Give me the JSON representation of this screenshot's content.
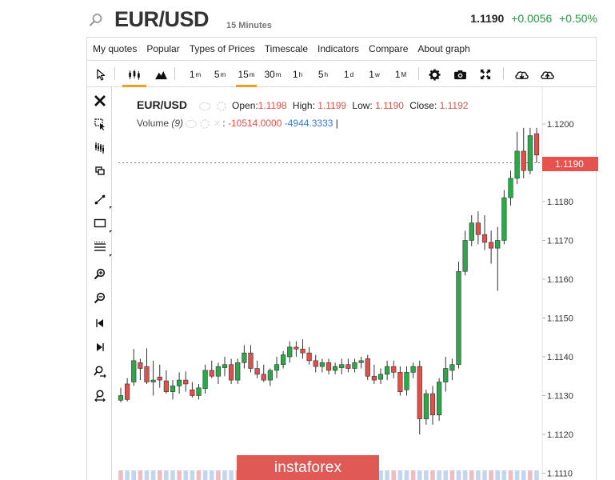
{
  "header": {
    "symbol": "EUR/USD",
    "timeframe": "15 Minutes",
    "last_price": "1.1190",
    "change": "+0.0056",
    "change_pct": "+0.50%",
    "colors": {
      "up": "#1e9b3b",
      "down": "#e0504a"
    }
  },
  "menu": {
    "items": [
      "My quotes",
      "Popular",
      "Types of Prices",
      "Timescale",
      "Indicators",
      "Compare",
      "About graph"
    ]
  },
  "toolbar": {
    "cursor_icon": "cursor-icon",
    "chart_types": [
      "candlestick-icon",
      "mountain-icon"
    ],
    "intervals": [
      {
        "value": "1",
        "unit": "m"
      },
      {
        "value": "5",
        "unit": "m"
      },
      {
        "value": "15",
        "unit": "m"
      },
      {
        "value": "30",
        "unit": "m"
      },
      {
        "value": "1",
        "unit": "h"
      },
      {
        "value": "5",
        "unit": "h"
      },
      {
        "value": "1",
        "unit": "d"
      },
      {
        "value": "1",
        "unit": "w"
      },
      {
        "value": "1",
        "unit": "M"
      }
    ],
    "active_interval": "15m",
    "actions": [
      "settings-icon",
      "camera-icon",
      "fullscreen-icon",
      "download-icon",
      "upload-icon"
    ]
  },
  "left_tools": [
    "close-icon",
    "cursor-select-icon",
    "magnet-icon",
    "copy-icon",
    "line-tool-icon",
    "rectangle-tool-icon",
    "horizontal-lines-icon",
    "zoom-in-icon",
    "zoom-out-icon",
    "scroll-left-icon",
    "scroll-right-icon",
    "zoom-time-icon",
    "zoom-reset-icon"
  ],
  "legend": {
    "symbol": "EUR/USD",
    "open_label": "Open:",
    "open": "1.1198",
    "high_label": "High:",
    "high": "1.1199",
    "low_label": "Low:",
    "low": "1.1190",
    "close_label": "Close:",
    "close": "1.1192",
    "volume_name": "Volume",
    "volume_period": "(9)",
    "volume_value1": "-10514.0000",
    "volume_value2": "-4944.3333"
  },
  "current_price_tag": "1.1190",
  "watermark": "instaforex",
  "chart_data": {
    "type": "candlestick",
    "y_axis_ticks": [
      "1.1200",
      "1.1190",
      "1.1180",
      "1.1170",
      "1.1160",
      "1.1150",
      "1.1140",
      "1.1130",
      "1.1120",
      "1.1110"
    ],
    "ylim": [
      1.1109,
      1.1208
    ],
    "current_price": 1.119,
    "up_color": "#2ba84a",
    "down_color": "#e0504a",
    "candles": [
      {
        "o": 1.11288,
        "h": 1.1132,
        "l": 1.11283,
        "c": 1.113
      },
      {
        "o": 1.1133,
        "h": 1.11345,
        "l": 1.11285,
        "c": 1.1129
      },
      {
        "o": 1.11335,
        "h": 1.1142,
        "l": 1.11325,
        "c": 1.1139
      },
      {
        "o": 1.11385,
        "h": 1.11395,
        "l": 1.1134,
        "c": 1.1137
      },
      {
        "o": 1.11375,
        "h": 1.11422,
        "l": 1.1133,
        "c": 1.11335
      },
      {
        "o": 1.11335,
        "h": 1.1139,
        "l": 1.113,
        "c": 1.1134
      },
      {
        "o": 1.11348,
        "h": 1.1138,
        "l": 1.1132,
        "c": 1.1134
      },
      {
        "o": 1.11338,
        "h": 1.11365,
        "l": 1.11305,
        "c": 1.1131
      },
      {
        "o": 1.1131,
        "h": 1.1134,
        "l": 1.1129,
        "c": 1.11325
      },
      {
        "o": 1.11325,
        "h": 1.1136,
        "l": 1.11305,
        "c": 1.1134
      },
      {
        "o": 1.1134,
        "h": 1.11362,
        "l": 1.1131,
        "c": 1.1133
      },
      {
        "o": 1.11315,
        "h": 1.11335,
        "l": 1.11295,
        "c": 1.113
      },
      {
        "o": 1.113,
        "h": 1.1133,
        "l": 1.1129,
        "c": 1.1132
      },
      {
        "o": 1.11318,
        "h": 1.1138,
        "l": 1.11305,
        "c": 1.11365
      },
      {
        "o": 1.11365,
        "h": 1.1139,
        "l": 1.11345,
        "c": 1.1135
      },
      {
        "o": 1.1135,
        "h": 1.11385,
        "l": 1.1133,
        "c": 1.11375
      },
      {
        "o": 1.11372,
        "h": 1.114,
        "l": 1.1135,
        "c": 1.1138
      },
      {
        "o": 1.1138,
        "h": 1.11395,
        "l": 1.1133,
        "c": 1.1134
      },
      {
        "o": 1.1134,
        "h": 1.11395,
        "l": 1.1133,
        "c": 1.11385
      },
      {
        "o": 1.11385,
        "h": 1.1143,
        "l": 1.1137,
        "c": 1.1141
      },
      {
        "o": 1.1141,
        "h": 1.1143,
        "l": 1.1136,
        "c": 1.1137
      },
      {
        "o": 1.1137,
        "h": 1.1139,
        "l": 1.11345,
        "c": 1.11355
      },
      {
        "o": 1.11355,
        "h": 1.1138,
        "l": 1.11335,
        "c": 1.1134
      },
      {
        "o": 1.1134,
        "h": 1.1137,
        "l": 1.11325,
        "c": 1.11365
      },
      {
        "o": 1.11365,
        "h": 1.114,
        "l": 1.11345,
        "c": 1.1138
      },
      {
        "o": 1.1138,
        "h": 1.11415,
        "l": 1.1137,
        "c": 1.11405
      },
      {
        "o": 1.114,
        "h": 1.1144,
        "l": 1.11385,
        "c": 1.11425
      },
      {
        "o": 1.11425,
        "h": 1.1144,
        "l": 1.114,
        "c": 1.1142
      },
      {
        "o": 1.1142,
        "h": 1.11445,
        "l": 1.11395,
        "c": 1.1141
      },
      {
        "o": 1.1141,
        "h": 1.11425,
        "l": 1.1138,
        "c": 1.1139
      },
      {
        "o": 1.1139,
        "h": 1.11405,
        "l": 1.1136,
        "c": 1.11375
      },
      {
        "o": 1.11375,
        "h": 1.11395,
        "l": 1.1136,
        "c": 1.11385
      },
      {
        "o": 1.11385,
        "h": 1.11395,
        "l": 1.11355,
        "c": 1.11365
      },
      {
        "o": 1.11365,
        "h": 1.11385,
        "l": 1.11355,
        "c": 1.11375
      },
      {
        "o": 1.11372,
        "h": 1.11395,
        "l": 1.11355,
        "c": 1.1138
      },
      {
        "o": 1.1138,
        "h": 1.11395,
        "l": 1.1136,
        "c": 1.1137
      },
      {
        "o": 1.1137,
        "h": 1.11395,
        "l": 1.1136,
        "c": 1.11385
      },
      {
        "o": 1.11385,
        "h": 1.114,
        "l": 1.1137,
        "c": 1.1139
      },
      {
        "o": 1.11395,
        "h": 1.11405,
        "l": 1.1134,
        "c": 1.1135
      },
      {
        "o": 1.1135,
        "h": 1.1138,
        "l": 1.1133,
        "c": 1.1134
      },
      {
        "o": 1.11342,
        "h": 1.1137,
        "l": 1.1133,
        "c": 1.11355
      },
      {
        "o": 1.11355,
        "h": 1.1139,
        "l": 1.1134,
        "c": 1.11375
      },
      {
        "o": 1.11375,
        "h": 1.1139,
        "l": 1.11345,
        "c": 1.1136
      },
      {
        "o": 1.1136,
        "h": 1.11375,
        "l": 1.113,
        "c": 1.1131
      },
      {
        "o": 1.11315,
        "h": 1.11375,
        "l": 1.113,
        "c": 1.1136
      },
      {
        "o": 1.1136,
        "h": 1.11385,
        "l": 1.11345,
        "c": 1.11375
      },
      {
        "o": 1.11375,
        "h": 1.1139,
        "l": 1.112,
        "c": 1.1124
      },
      {
        "o": 1.1124,
        "h": 1.11315,
        "l": 1.11225,
        "c": 1.11305
      },
      {
        "o": 1.11305,
        "h": 1.11325,
        "l": 1.11225,
        "c": 1.1125
      },
      {
        "o": 1.1125,
        "h": 1.11345,
        "l": 1.11235,
        "c": 1.11335
      },
      {
        "o": 1.11335,
        "h": 1.114,
        "l": 1.1131,
        "c": 1.1137
      },
      {
        "o": 1.11365,
        "h": 1.11395,
        "l": 1.1134,
        "c": 1.1138
      },
      {
        "o": 1.1138,
        "h": 1.11645,
        "l": 1.1137,
        "c": 1.1162
      },
      {
        "o": 1.1162,
        "h": 1.11725,
        "l": 1.1161,
        "c": 1.117
      },
      {
        "o": 1.117,
        "h": 1.11765,
        "l": 1.11685,
        "c": 1.11745
      },
      {
        "o": 1.11745,
        "h": 1.11775,
        "l": 1.1169,
        "c": 1.11715
      },
      {
        "o": 1.11715,
        "h": 1.11765,
        "l": 1.11675,
        "c": 1.11695
      },
      {
        "o": 1.11695,
        "h": 1.11725,
        "l": 1.1164,
        "c": 1.1168
      },
      {
        "o": 1.1168,
        "h": 1.11735,
        "l": 1.1157,
        "c": 1.117
      },
      {
        "o": 1.117,
        "h": 1.1183,
        "l": 1.1169,
        "c": 1.1181
      },
      {
        "o": 1.1181,
        "h": 1.1188,
        "l": 1.1179,
        "c": 1.1186
      },
      {
        "o": 1.1186,
        "h": 1.1198,
        "l": 1.11845,
        "c": 1.1193
      },
      {
        "o": 1.1193,
        "h": 1.1199,
        "l": 1.1186,
        "c": 1.1188
      },
      {
        "o": 1.1188,
        "h": 1.1199,
        "l": 1.1187,
        "c": 1.1197
      },
      {
        "o": 1.11975,
        "h": 1.1199,
        "l": 1.119,
        "c": 1.1192
      }
    ]
  }
}
